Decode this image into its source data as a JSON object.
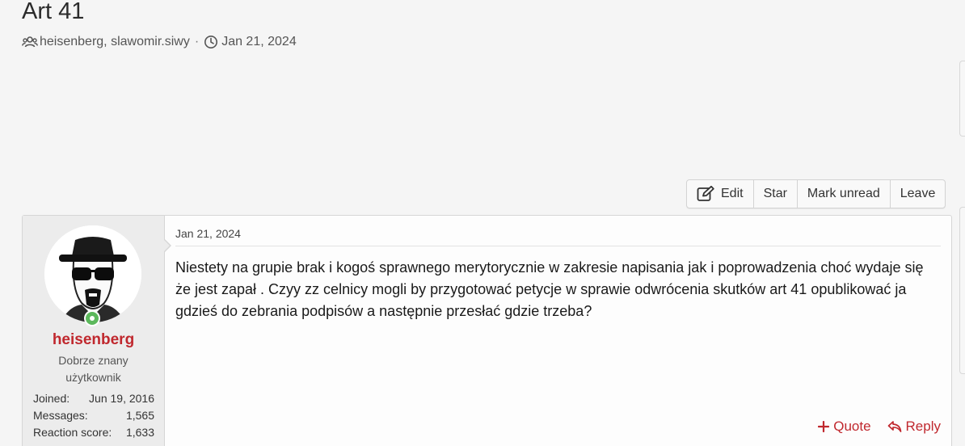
{
  "thread": {
    "title": "Art 41",
    "participants": "heisenberg, slawomir.siwy",
    "separator": "·",
    "date": "Jan 21, 2024"
  },
  "toolbar": {
    "edit_label": "Edit",
    "star_label": "Star",
    "mark_unread_label": "Mark unread",
    "leave_label": "Leave"
  },
  "post": {
    "date": "Jan 21, 2024",
    "body": "Niestety na grupie brak i kogoś sprawnego merytorycznie w zakresie napisania jak i poprowadzenia choć wydaje się że jest zapał . Czyy zz celnicy mogli by przygotować petycje w sprawie odwrócenia skutków art 41 opublikować ja gdzieś do zebrania podpisów a następnie przesłać gdzie trzeba?",
    "author": {
      "name": "heisenberg",
      "title_line1": "Dobrze znany",
      "title_line2": "użytkownik",
      "online": true,
      "stats": [
        {
          "label": "Joined:",
          "value": "Jun 19, 2016"
        },
        {
          "label": "Messages:",
          "value": "1,565"
        },
        {
          "label": "Reaction score:",
          "value": "1,633"
        }
      ]
    },
    "actions": {
      "quote_label": "Quote",
      "reply_label": "Reply"
    }
  },
  "icons": {
    "participants": "users-icon",
    "date": "clock-icon",
    "edit": "edit-icon",
    "quote": "plus-icon",
    "reply": "reply-icon"
  },
  "colors": {
    "accent": "#c0282e",
    "online": "#5cb85c"
  }
}
